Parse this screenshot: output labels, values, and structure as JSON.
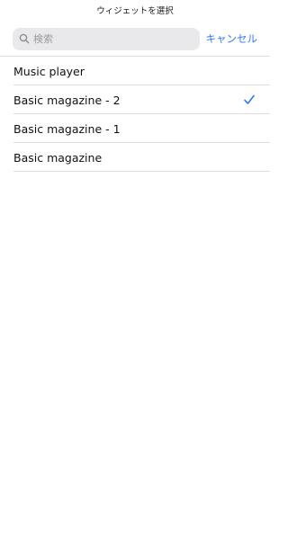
{
  "header": {
    "title": "ウィジェットを選択"
  },
  "search": {
    "placeholder": "検索",
    "value": "",
    "cancel_label": "キャンセル"
  },
  "list": {
    "items": [
      {
        "label": "Music player",
        "selected": false
      },
      {
        "label": "Basic magazine - 2",
        "selected": true
      },
      {
        "label": "Basic magazine - 1",
        "selected": false
      },
      {
        "label": "Basic magazine",
        "selected": false
      }
    ]
  },
  "colors": {
    "accent": "#3478f6",
    "search_background": "#e9e9eb",
    "separator": "#dcdcde"
  },
  "icons": {
    "search": "magnifying-glass-icon",
    "check": "checkmark-icon"
  }
}
